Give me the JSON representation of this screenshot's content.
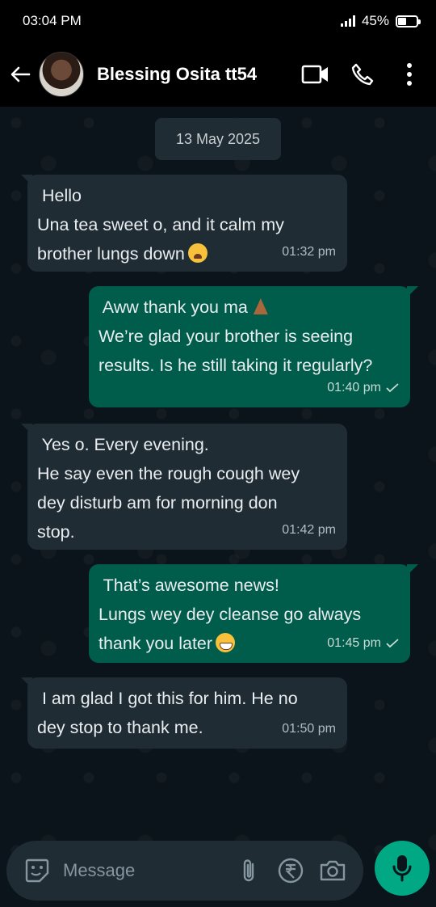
{
  "status": {
    "time": "03:04 PM",
    "battery": "45%",
    "battery_level": 0.45
  },
  "header": {
    "contact_name": "Blessing Osita tt54"
  },
  "chat": {
    "date": "13 May 2025",
    "messages": [
      {
        "direction": "in",
        "lines": [
          " Hello",
          "Una tea sweet o, and it calm my",
          "brother lungs down"
        ],
        "emoji": "weary-face",
        "time": "01:32 pm"
      },
      {
        "direction": "out",
        "lines": [
          " Aww thank you ma",
          "We’re glad your brother is seeing",
          "results. Is he still taking it regularly?"
        ],
        "emoji": "folded-hands",
        "time": "01:40 pm",
        "status": "sent-check"
      },
      {
        "direction": "in",
        "lines": [
          " Yes o. Every evening.",
          "He say even the rough cough wey",
          "dey disturb am for morning don",
          "stop."
        ],
        "time": "01:42 pm"
      },
      {
        "direction": "out",
        "lines": [
          " That’s awesome news!",
          "Lungs wey dey cleanse go always",
          "thank you later"
        ],
        "emoji": "grinning-face",
        "time": "01:45 pm",
        "status": "sent-check"
      },
      {
        "direction": "in",
        "lines": [
          " I am glad I got this for him. He no",
          "dey stop to thank me."
        ],
        "time": "01:50 pm"
      }
    ]
  },
  "composer": {
    "placeholder": "Message"
  },
  "icons": {
    "back": "back-arrow-icon",
    "video": "video-call-icon",
    "voice": "phone-icon",
    "menu": "more-vertical-icon",
    "emoji": "emoji-sticker-icon",
    "attach": "paperclip-icon",
    "payment": "rupee-payment-icon",
    "camera": "camera-icon",
    "mic": "microphone-icon"
  },
  "colors": {
    "incoming": "#1f2c34",
    "outgoing": "#005c4b",
    "accent": "#00a884"
  }
}
